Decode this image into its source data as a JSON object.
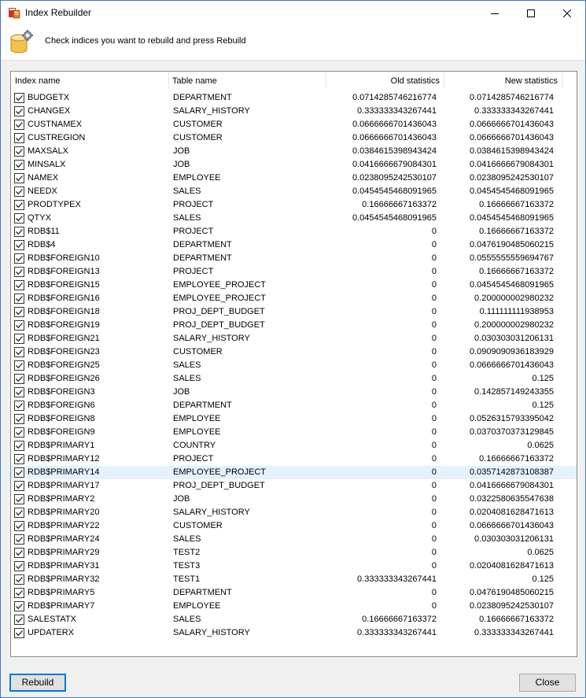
{
  "window": {
    "title": "Index Rebuilder",
    "minimize_icon": "minimize-icon",
    "maximize_icon": "maximize-icon",
    "close_icon": "close-icon",
    "app_icon": "database-rebuild-icon"
  },
  "header": {
    "instruction": "Check indices you want to rebuild and press Rebuild",
    "icon": "database-gear-icon"
  },
  "grid": {
    "columns": [
      "Index name",
      "Table name",
      "Old statistics",
      "New statistics"
    ],
    "selected_row": 28,
    "rows": [
      {
        "checked": true,
        "index": "BUDGETX",
        "table": "DEPARTMENT",
        "old": "0.0714285746216774",
        "new": "0.0714285746216774"
      },
      {
        "checked": true,
        "index": "CHANGEX",
        "table": "SALARY_HISTORY",
        "old": "0.333333343267441",
        "new": "0.333333343267441"
      },
      {
        "checked": true,
        "index": "CUSTNAMEX",
        "table": "CUSTOMER",
        "old": "0.0666666701436043",
        "new": "0.0666666701436043"
      },
      {
        "checked": true,
        "index": "CUSTREGION",
        "table": "CUSTOMER",
        "old": "0.0666666701436043",
        "new": "0.0666666701436043"
      },
      {
        "checked": true,
        "index": "MAXSALX",
        "table": "JOB",
        "old": "0.0384615398943424",
        "new": "0.0384615398943424"
      },
      {
        "checked": true,
        "index": "MINSALX",
        "table": "JOB",
        "old": "0.0416666679084301",
        "new": "0.0416666679084301"
      },
      {
        "checked": true,
        "index": "NAMEX",
        "table": "EMPLOYEE",
        "old": "0.0238095242530107",
        "new": "0.0238095242530107"
      },
      {
        "checked": true,
        "index": "NEEDX",
        "table": "SALES",
        "old": "0.0454545468091965",
        "new": "0.0454545468091965"
      },
      {
        "checked": true,
        "index": "PRODTYPEX",
        "table": "PROJECT",
        "old": "0.16666667163372",
        "new": "0.16666667163372"
      },
      {
        "checked": true,
        "index": "QTYX",
        "table": "SALES",
        "old": "0.0454545468091965",
        "new": "0.0454545468091965"
      },
      {
        "checked": true,
        "index": "RDB$11",
        "table": "PROJECT",
        "old": "0",
        "new": "0.16666667163372"
      },
      {
        "checked": true,
        "index": "RDB$4",
        "table": "DEPARTMENT",
        "old": "0",
        "new": "0.0476190485060215"
      },
      {
        "checked": true,
        "index": "RDB$FOREIGN10",
        "table": "DEPARTMENT",
        "old": "0",
        "new": "0.0555555559694767"
      },
      {
        "checked": true,
        "index": "RDB$FOREIGN13",
        "table": "PROJECT",
        "old": "0",
        "new": "0.16666667163372"
      },
      {
        "checked": true,
        "index": "RDB$FOREIGN15",
        "table": "EMPLOYEE_PROJECT",
        "old": "0",
        "new": "0.0454545468091965"
      },
      {
        "checked": true,
        "index": "RDB$FOREIGN16",
        "table": "EMPLOYEE_PROJECT",
        "old": "0",
        "new": "0.200000002980232"
      },
      {
        "checked": true,
        "index": "RDB$FOREIGN18",
        "table": "PROJ_DEPT_BUDGET",
        "old": "0",
        "new": "0.111111111938953"
      },
      {
        "checked": true,
        "index": "RDB$FOREIGN19",
        "table": "PROJ_DEPT_BUDGET",
        "old": "0",
        "new": "0.200000002980232"
      },
      {
        "checked": true,
        "index": "RDB$FOREIGN21",
        "table": "SALARY_HISTORY",
        "old": "0",
        "new": "0.030303031206131"
      },
      {
        "checked": true,
        "index": "RDB$FOREIGN23",
        "table": "CUSTOMER",
        "old": "0",
        "new": "0.0909090936183929"
      },
      {
        "checked": true,
        "index": "RDB$FOREIGN25",
        "table": "SALES",
        "old": "0",
        "new": "0.0666666701436043"
      },
      {
        "checked": true,
        "index": "RDB$FOREIGN26",
        "table": "SALES",
        "old": "0",
        "new": "0.125"
      },
      {
        "checked": true,
        "index": "RDB$FOREIGN3",
        "table": "JOB",
        "old": "0",
        "new": "0.142857149243355"
      },
      {
        "checked": true,
        "index": "RDB$FOREIGN6",
        "table": "DEPARTMENT",
        "old": "0",
        "new": "0.125"
      },
      {
        "checked": true,
        "index": "RDB$FOREIGN8",
        "table": "EMPLOYEE",
        "old": "0",
        "new": "0.0526315793395042"
      },
      {
        "checked": true,
        "index": "RDB$FOREIGN9",
        "table": "EMPLOYEE",
        "old": "0",
        "new": "0.0370370373129845"
      },
      {
        "checked": true,
        "index": "RDB$PRIMARY1",
        "table": "COUNTRY",
        "old": "0",
        "new": "0.0625"
      },
      {
        "checked": true,
        "index": "RDB$PRIMARY12",
        "table": "PROJECT",
        "old": "0",
        "new": "0.16666667163372"
      },
      {
        "checked": true,
        "index": "RDB$PRIMARY14",
        "table": "EMPLOYEE_PROJECT",
        "old": "0",
        "new": "0.0357142873108387"
      },
      {
        "checked": true,
        "index": "RDB$PRIMARY17",
        "table": "PROJ_DEPT_BUDGET",
        "old": "0",
        "new": "0.0416666679084301"
      },
      {
        "checked": true,
        "index": "RDB$PRIMARY2",
        "table": "JOB",
        "old": "0",
        "new": "0.0322580635547638"
      },
      {
        "checked": true,
        "index": "RDB$PRIMARY20",
        "table": "SALARY_HISTORY",
        "old": "0",
        "new": "0.0204081628471613"
      },
      {
        "checked": true,
        "index": "RDB$PRIMARY22",
        "table": "CUSTOMER",
        "old": "0",
        "new": "0.0666666701436043"
      },
      {
        "checked": true,
        "index": "RDB$PRIMARY24",
        "table": "SALES",
        "old": "0",
        "new": "0.030303031206131"
      },
      {
        "checked": true,
        "index": "RDB$PRIMARY29",
        "table": "TEST2",
        "old": "0",
        "new": "0.0625"
      },
      {
        "checked": true,
        "index": "RDB$PRIMARY31",
        "table": "TEST3",
        "old": "0",
        "new": "0.0204081628471613"
      },
      {
        "checked": true,
        "index": "RDB$PRIMARY32",
        "table": "TEST1",
        "old": "0.333333343267441",
        "new": "0.125"
      },
      {
        "checked": true,
        "index": "RDB$PRIMARY5",
        "table": "DEPARTMENT",
        "old": "0",
        "new": "0.0476190485060215"
      },
      {
        "checked": true,
        "index": "RDB$PRIMARY7",
        "table": "EMPLOYEE",
        "old": "0",
        "new": "0.0238095242530107"
      },
      {
        "checked": true,
        "index": "SALESTATX",
        "table": "SALES",
        "old": "0.16666667163372",
        "new": "0.16666667163372"
      },
      {
        "checked": true,
        "index": "UPDATERX",
        "table": "SALARY_HISTORY",
        "old": "0.333333343267441",
        "new": "0.333333343267441"
      }
    ]
  },
  "buttons": {
    "rebuild": "Rebuild",
    "close": "Close"
  },
  "colors": {
    "accent": "#0078d7",
    "selection": "#e5f1fb",
    "window_border": "#3a78c8"
  }
}
